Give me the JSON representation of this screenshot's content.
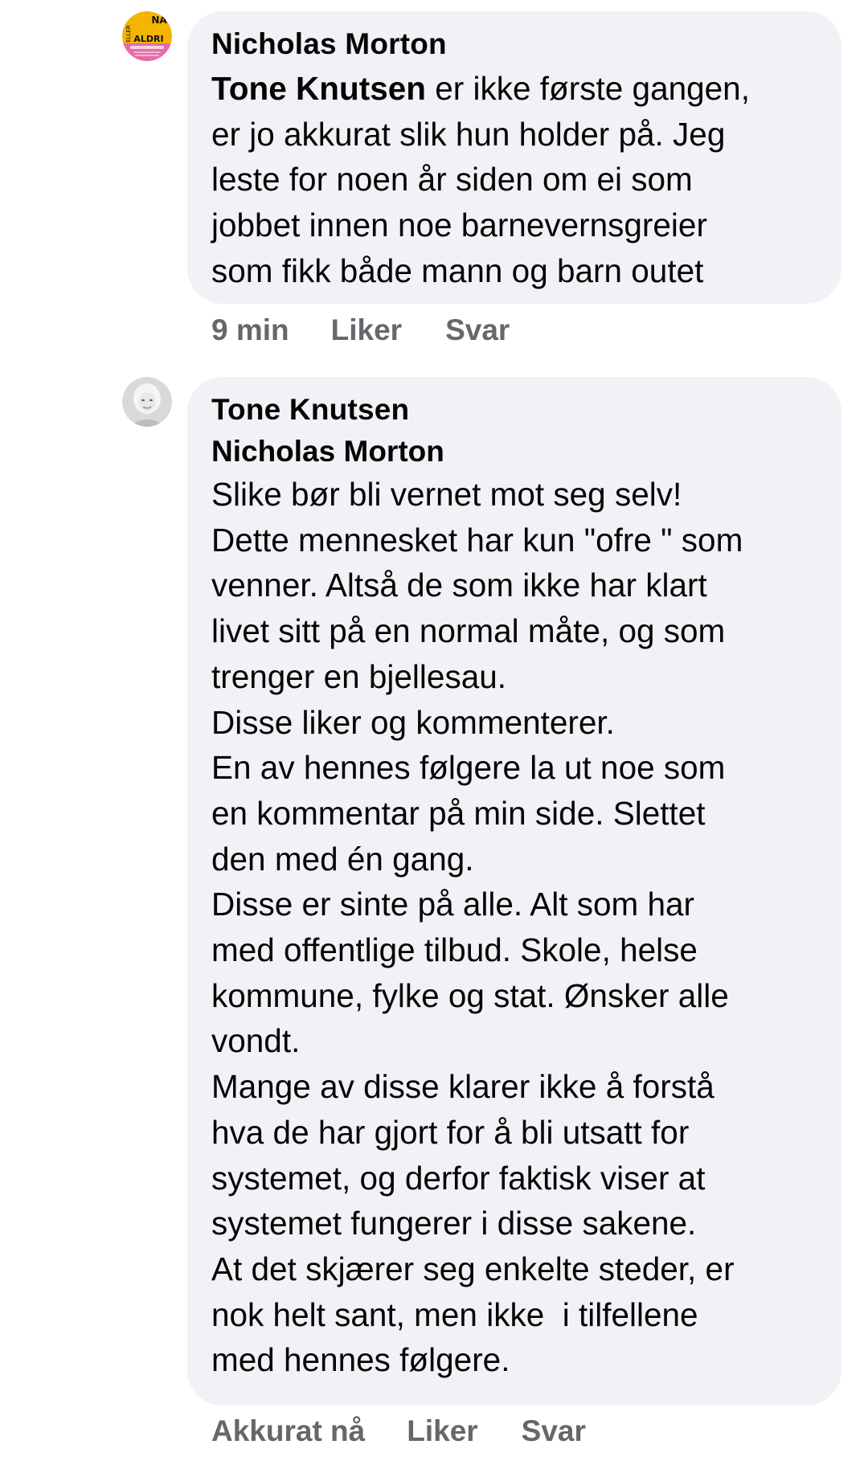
{
  "comments": [
    {
      "author": "Nicholas Morton",
      "avatar": {
        "type": "logo-badge",
        "text_top": "NA",
        "text_side": "ELLER",
        "text_mid": "ALDRI",
        "accent": "#f4b400",
        "secondary": "#e86aa8"
      },
      "mention": "Tone Knutsen",
      "lines": [
        " er ikke første gangen,",
        "er jo akkurat slik hun holder på. Jeg",
        "leste for noen år siden om ei som",
        "jobbet innen noe barnevernsgreier",
        "som fikk både mann og barn outet"
      ],
      "time": "9 min",
      "like_label": "Liker",
      "reply_label": "Svar"
    },
    {
      "author": "Tone Knutsen",
      "avatar": {
        "type": "photo-bw"
      },
      "mention": "Nicholas Morton",
      "lines": [
        "Slike bør bli vernet mot seg selv!",
        "Dette mennesket har kun \"ofre \" som",
        "venner. Altså de som ikke har klart",
        "livet sitt på en normal måte, og som",
        "trenger en bjellesau.",
        "Disse liker og kommenterer.",
        "En av hennes følgere la ut noe som",
        "en kommentar på min side. Slettet",
        "den med én gang.",
        "Disse er sinte på alle. Alt som har",
        "med offentlige tilbud. Skole, helse",
        "kommune, fylke og stat. Ønsker alle",
        "vondt.",
        "Mange av disse klarer ikke å forstå",
        "hva de har gjort for å bli utsatt for",
        "systemet, og derfor faktisk viser at",
        "systemet fungerer i disse sakene.",
        "At det skjærer seg enkelte steder, er",
        "nok helt sant, men ikke  i tilfellene",
        "med hennes følgere."
      ],
      "time": "Akkurat nå",
      "like_label": "Liker",
      "reply_label": "Svar"
    }
  ],
  "colors": {
    "bubble": "#f0f2f5",
    "text": "#050505",
    "meta": "#65676b"
  }
}
